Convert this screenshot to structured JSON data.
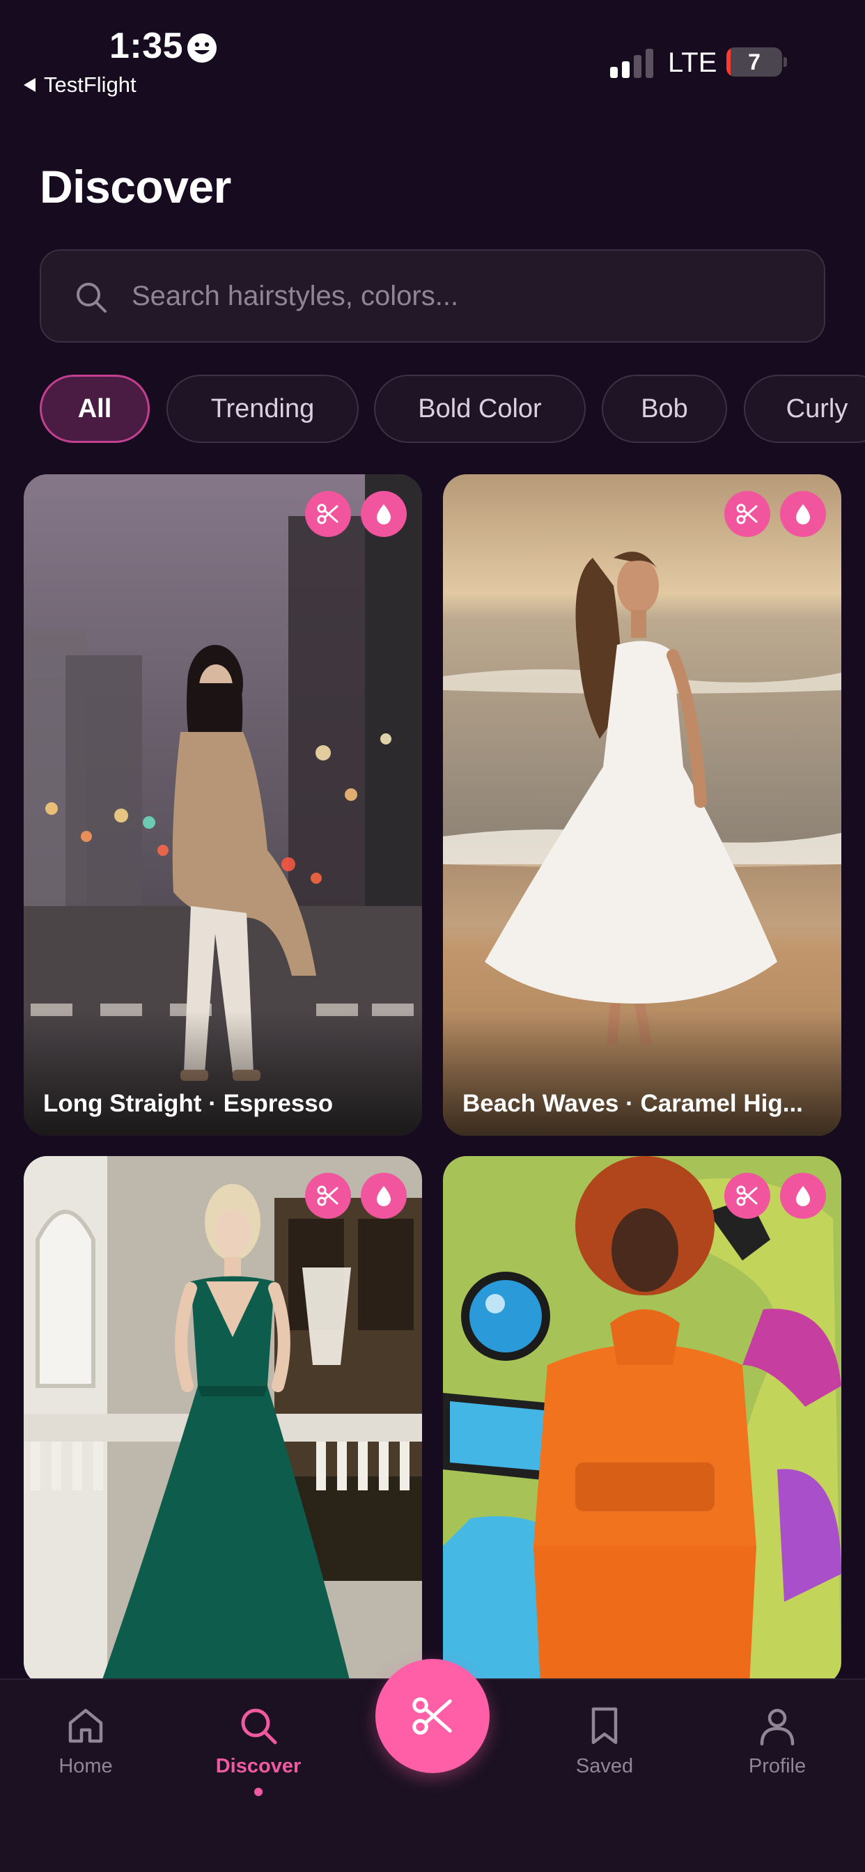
{
  "status_bar": {
    "time": "1:35",
    "back_app": "TestFlight",
    "network": "LTE",
    "battery": "7",
    "battery_level": 0.07
  },
  "page": {
    "title": "Discover"
  },
  "search": {
    "placeholder": "Search hairstyles, colors..."
  },
  "chips": [
    {
      "label": "All",
      "active": true
    },
    {
      "label": "Trending",
      "active": false
    },
    {
      "label": "Bold Color",
      "active": false
    },
    {
      "label": "Bob",
      "active": false
    },
    {
      "label": "Curly",
      "active": false
    }
  ],
  "cards": [
    {
      "caption": "Long Straight · Espresso"
    },
    {
      "caption": "Beach Waves · Caramel Hig..."
    },
    {
      "caption": ""
    },
    {
      "caption": ""
    }
  ],
  "nav": {
    "items": [
      {
        "label": "Home",
        "icon": "home-icon"
      },
      {
        "label": "Discover",
        "icon": "search-icon",
        "active": true
      },
      {
        "label": "Saved",
        "icon": "bookmark-icon"
      },
      {
        "label": "Profile",
        "icon": "person-icon"
      }
    ],
    "fab_icon": "scissors-icon"
  },
  "colors": {
    "accent": "#f0559d",
    "background": "#170c1f"
  }
}
